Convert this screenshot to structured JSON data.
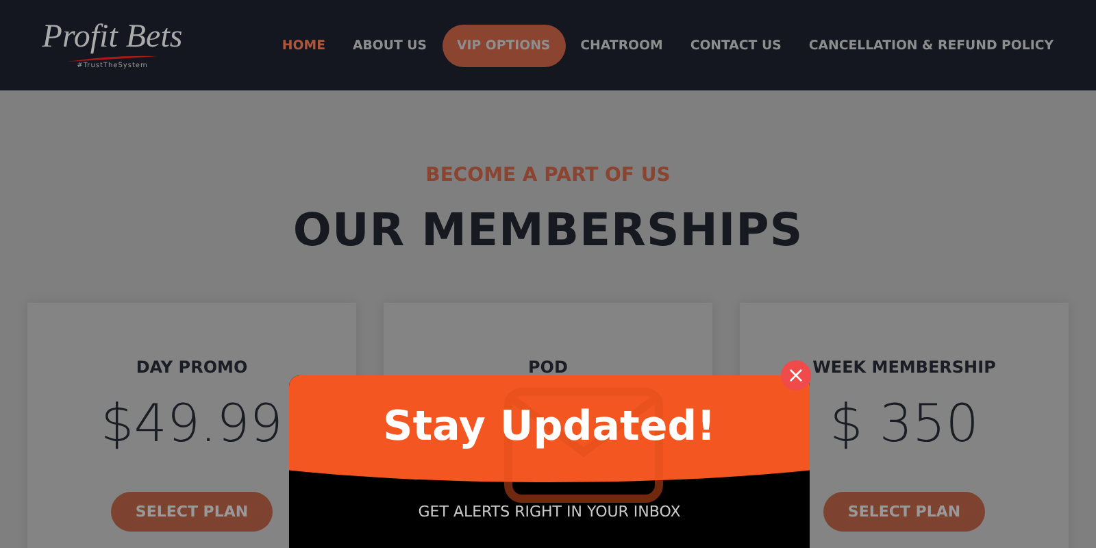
{
  "logo": {
    "name": "Profit Bets",
    "tagline": "#TrustTheSystem"
  },
  "nav": [
    {
      "label": "HOME",
      "selected": true,
      "kind": "link"
    },
    {
      "label": "ABOUT US",
      "selected": false,
      "kind": "link"
    },
    {
      "label": "VIP OPTIONS",
      "selected": false,
      "kind": "pill"
    },
    {
      "label": "CHATROOM",
      "selected": false,
      "kind": "link"
    },
    {
      "label": "CONTACT US",
      "selected": false,
      "kind": "link"
    },
    {
      "label": "CANCELLATION & REFUND POLICY",
      "selected": false,
      "kind": "link"
    }
  ],
  "section": {
    "eyebrow": "BECOME A PART OF US",
    "title": "OUR MEMBERSHIPS"
  },
  "plans": [
    {
      "name": "DAY PROMO",
      "price": "$49.99",
      "button": "SELECT PLAN"
    },
    {
      "name": "POD"
    },
    {
      "name": "WEEK MEMBERSHIP",
      "price": "$ 350",
      "button": "SELECT PLAN"
    }
  ],
  "popup": {
    "title": "Stay Updated!",
    "subtitle": "GET ALERTS RIGHT IN YOUR INBOX",
    "close": "×"
  }
}
